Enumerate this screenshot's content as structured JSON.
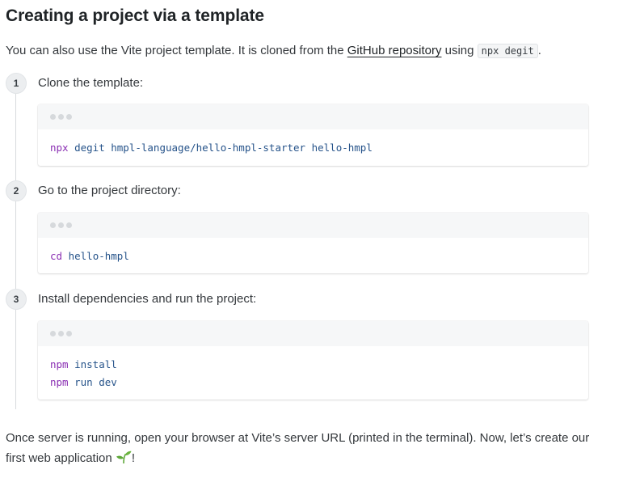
{
  "heading": "Creating a project via a template",
  "intro": {
    "text_before": "You can also use the Vite project template. It is cloned from the ",
    "link_text": "GitHub repository",
    "text_middle": " using ",
    "code": "npx degit",
    "text_after": "."
  },
  "steps": [
    {
      "number": "1",
      "title": "Clone the template:",
      "lines": [
        {
          "cmd": "npx",
          "args": " degit hmpl-language/hello-hmpl-starter hello-hmpl"
        }
      ]
    },
    {
      "number": "2",
      "title": "Go to the project directory:",
      "lines": [
        {
          "cmd": "cd",
          "args": " hello-hmpl"
        }
      ]
    },
    {
      "number": "3",
      "title": "Install dependencies and run the project:",
      "lines": [
        {
          "cmd": "npm",
          "args": " install"
        },
        {
          "cmd": "npm",
          "args": " run dev"
        }
      ]
    }
  ],
  "outro": {
    "text": "Once server is running, open your browser at Vite’s server URL (printed in the terminal). Now, let’s create our first web application ",
    "end": "!",
    "emoji_icon": "seedling-icon"
  },
  "colors": {
    "command": "#8a2fb3",
    "argument": "#26538a",
    "emoji": "#5fa83a"
  }
}
